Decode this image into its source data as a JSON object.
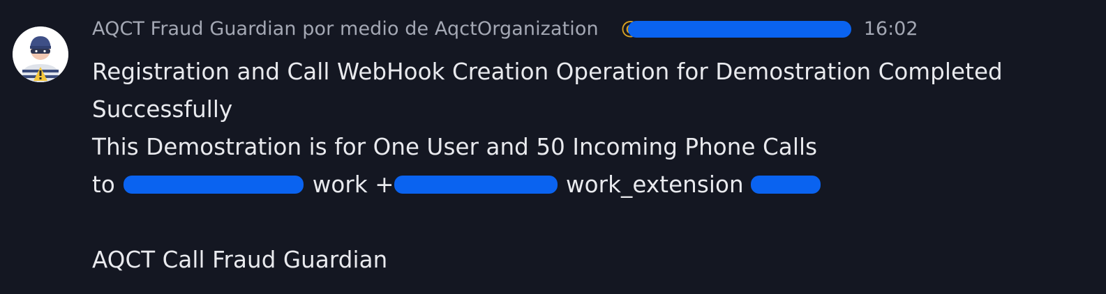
{
  "message": {
    "sender": "AQCT Fraud Guardian por medio de AqctOrganization",
    "handle_prefix": "@",
    "time": "16:02",
    "lines": {
      "line1": "Registration and Call WebHook Creation Operation for Demostration Completed",
      "line2": "Successfully",
      "line3": "This Demostration is for One User and 50 Incoming Phone Calls",
      "line4_to": "to",
      "line4_work": "work",
      "line4_plus": "+",
      "line4_work_ext": "work_extension",
      "signature": "AQCT Call Fraud Guardian"
    }
  },
  "colors": {
    "background": "#141722",
    "text": "#e9eaee",
    "muted": "#a4a8b4",
    "handle": "#d8a223",
    "redaction": "#0a63f0"
  },
  "icons": {
    "avatar": "fraud-guardian-avatar-icon"
  }
}
